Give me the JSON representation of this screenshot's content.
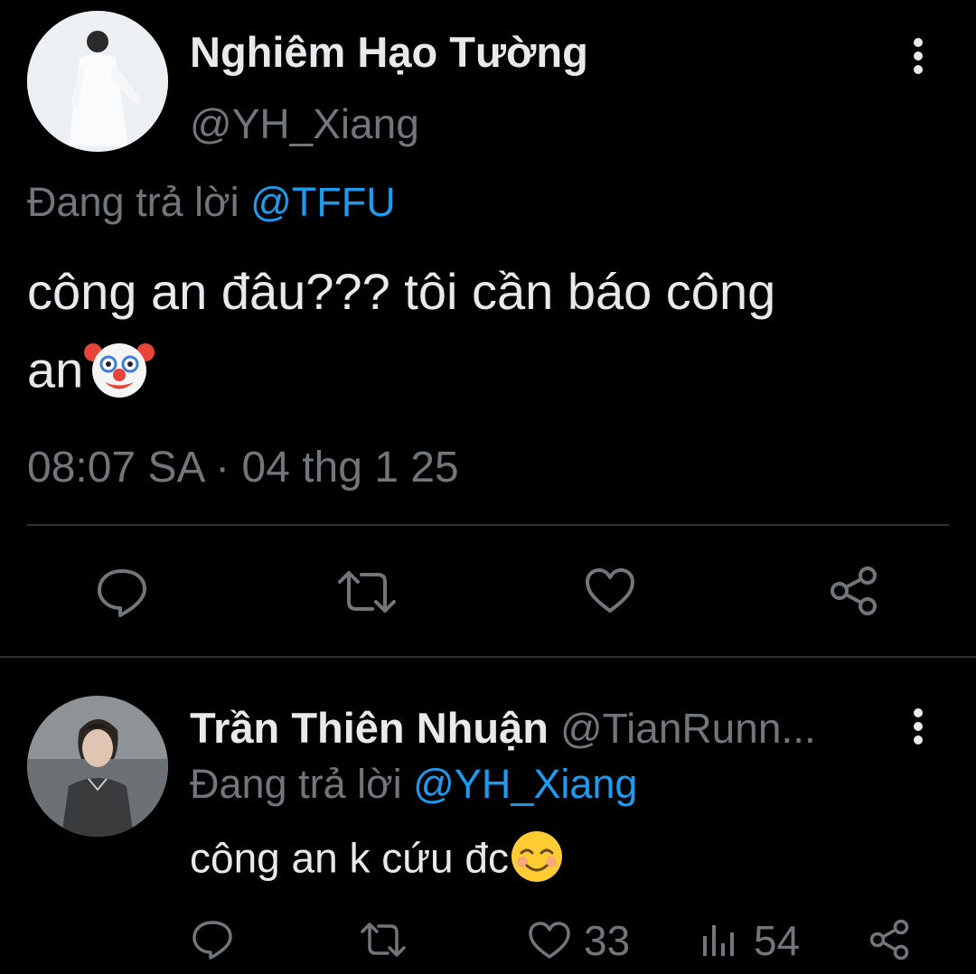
{
  "tweet": {
    "author_name": "Nghiêm Hạo Tường",
    "author_handle": "@YH_Xiang",
    "replying_prefix": "Đang trả lời",
    "replying_to": "@TFFU",
    "text_line1": "công an đâu??? tôi cần báo công",
    "text_line2": "an",
    "text_emoji": "clown-face-emoji",
    "timestamp": "08:07 SA · 04 thg 1 25",
    "actions": [
      "reply-icon",
      "retweet-icon",
      "like-icon",
      "share-icon"
    ]
  },
  "reply": {
    "author_name": "Trần Thiên Nhuận",
    "author_handle": "@TianRunn...",
    "replying_prefix": "Đang trả lời",
    "replying_to": "@YH_Xiang",
    "text": "công an k cứu đc",
    "text_emoji": "smiling-face-emoji",
    "like_count": "33",
    "view_count": "54",
    "actions": [
      "reply-icon",
      "retweet-icon",
      "like-icon",
      "views-icon",
      "share-icon"
    ]
  },
  "colors": {
    "background": "#000000",
    "text": "#e7e9ea",
    "muted": "#71767b",
    "accent": "#1d9bf0",
    "divider": "#2f3336"
  }
}
